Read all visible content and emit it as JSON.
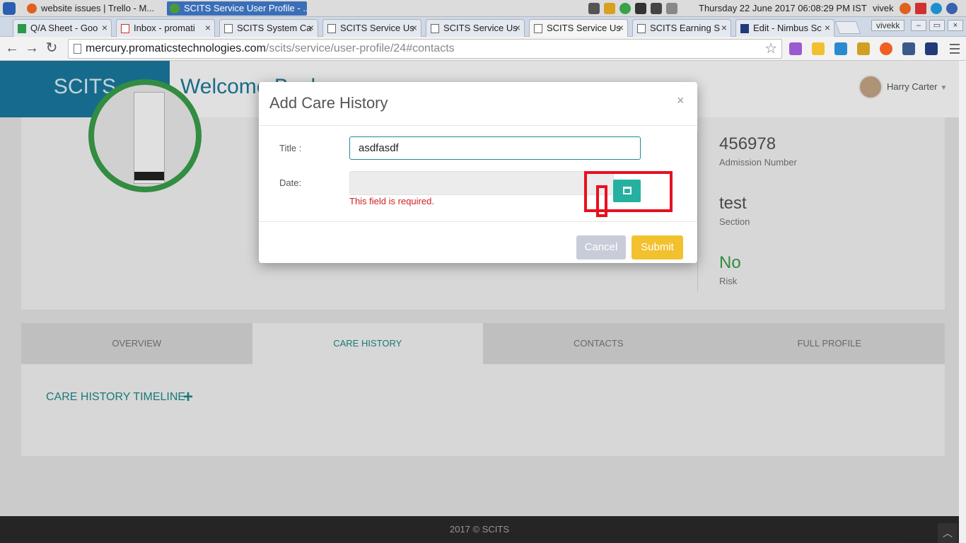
{
  "os": {
    "tasks": [
      {
        "label": "website issues | Trello - M...",
        "icon_color": "#e06020"
      },
      {
        "label": "SCITS Service User Profile - ...",
        "icon_color": "#4a9a3a"
      }
    ],
    "clock": "Thursday 22 June 2017   06:08:29 PM IST",
    "user": "vivek"
  },
  "browser": {
    "tabs": [
      {
        "label": "Q/A Sheet - Goo"
      },
      {
        "label": "Inbox - promati"
      },
      {
        "label": "SCITS System Ca"
      },
      {
        "label": "SCITS Service Us"
      },
      {
        "label": "SCITS Service Us"
      },
      {
        "label": "SCITS Service Us"
      },
      {
        "label": "SCITS Earning S"
      },
      {
        "label": "Edit - Nimbus Sc"
      }
    ],
    "profile_badge": "vivekk",
    "url_host": "mercury.promaticstechnologies.com",
    "url_path": "/scits/service/user-profile/24#contacts"
  },
  "app": {
    "brand": "SCITS",
    "welcome": "Welcome Back",
    "user_name": "Harry Carter"
  },
  "profile": {
    "stats": [
      {
        "value": "456978",
        "label": "Admission Number"
      },
      {
        "value": "test",
        "label": "Section"
      },
      {
        "value": "No",
        "label": "Risk"
      }
    ]
  },
  "tabs": [
    {
      "label": "OVERVIEW"
    },
    {
      "label": "CARE HISTORY"
    },
    {
      "label": "CONTACTS"
    },
    {
      "label": "FULL PROFILE"
    }
  ],
  "timeline": {
    "heading": "CARE HISTORY TIMELINE",
    "add_icon": "+"
  },
  "footer": "2017 © SCITS",
  "modal": {
    "title": "Add Care History",
    "close": "×",
    "title_label": "Title :",
    "title_value": "asdfasdf",
    "date_label": "Date:",
    "date_error": "This field is required.",
    "cancel": "Cancel",
    "submit": "Submit"
  },
  "colors": {
    "brand": "#1a7aa0",
    "accent": "#26b0a0",
    "submit": "#f2c12e",
    "error": "#cc2222",
    "annotation": "#e81020"
  }
}
